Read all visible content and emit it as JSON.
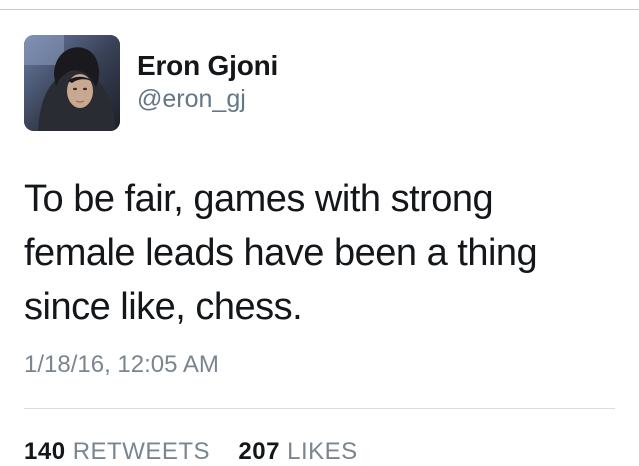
{
  "tweet": {
    "author": {
      "display_name": "Eron Gjoni",
      "handle": "@eron_gj",
      "avatar_icon": "profile-photo"
    },
    "text": "To be fair, games with strong female leads have been a thing since like, chess.",
    "timestamp": "1/18/16, 12:05 AM",
    "stats": {
      "retweets_count": "140",
      "retweets_label": "RETWEETS",
      "likes_count": "207",
      "likes_label": "LIKES"
    }
  },
  "colors": {
    "text_primary": "#14171a",
    "text_secondary": "#657786",
    "divider": "#dcdcdf"
  }
}
